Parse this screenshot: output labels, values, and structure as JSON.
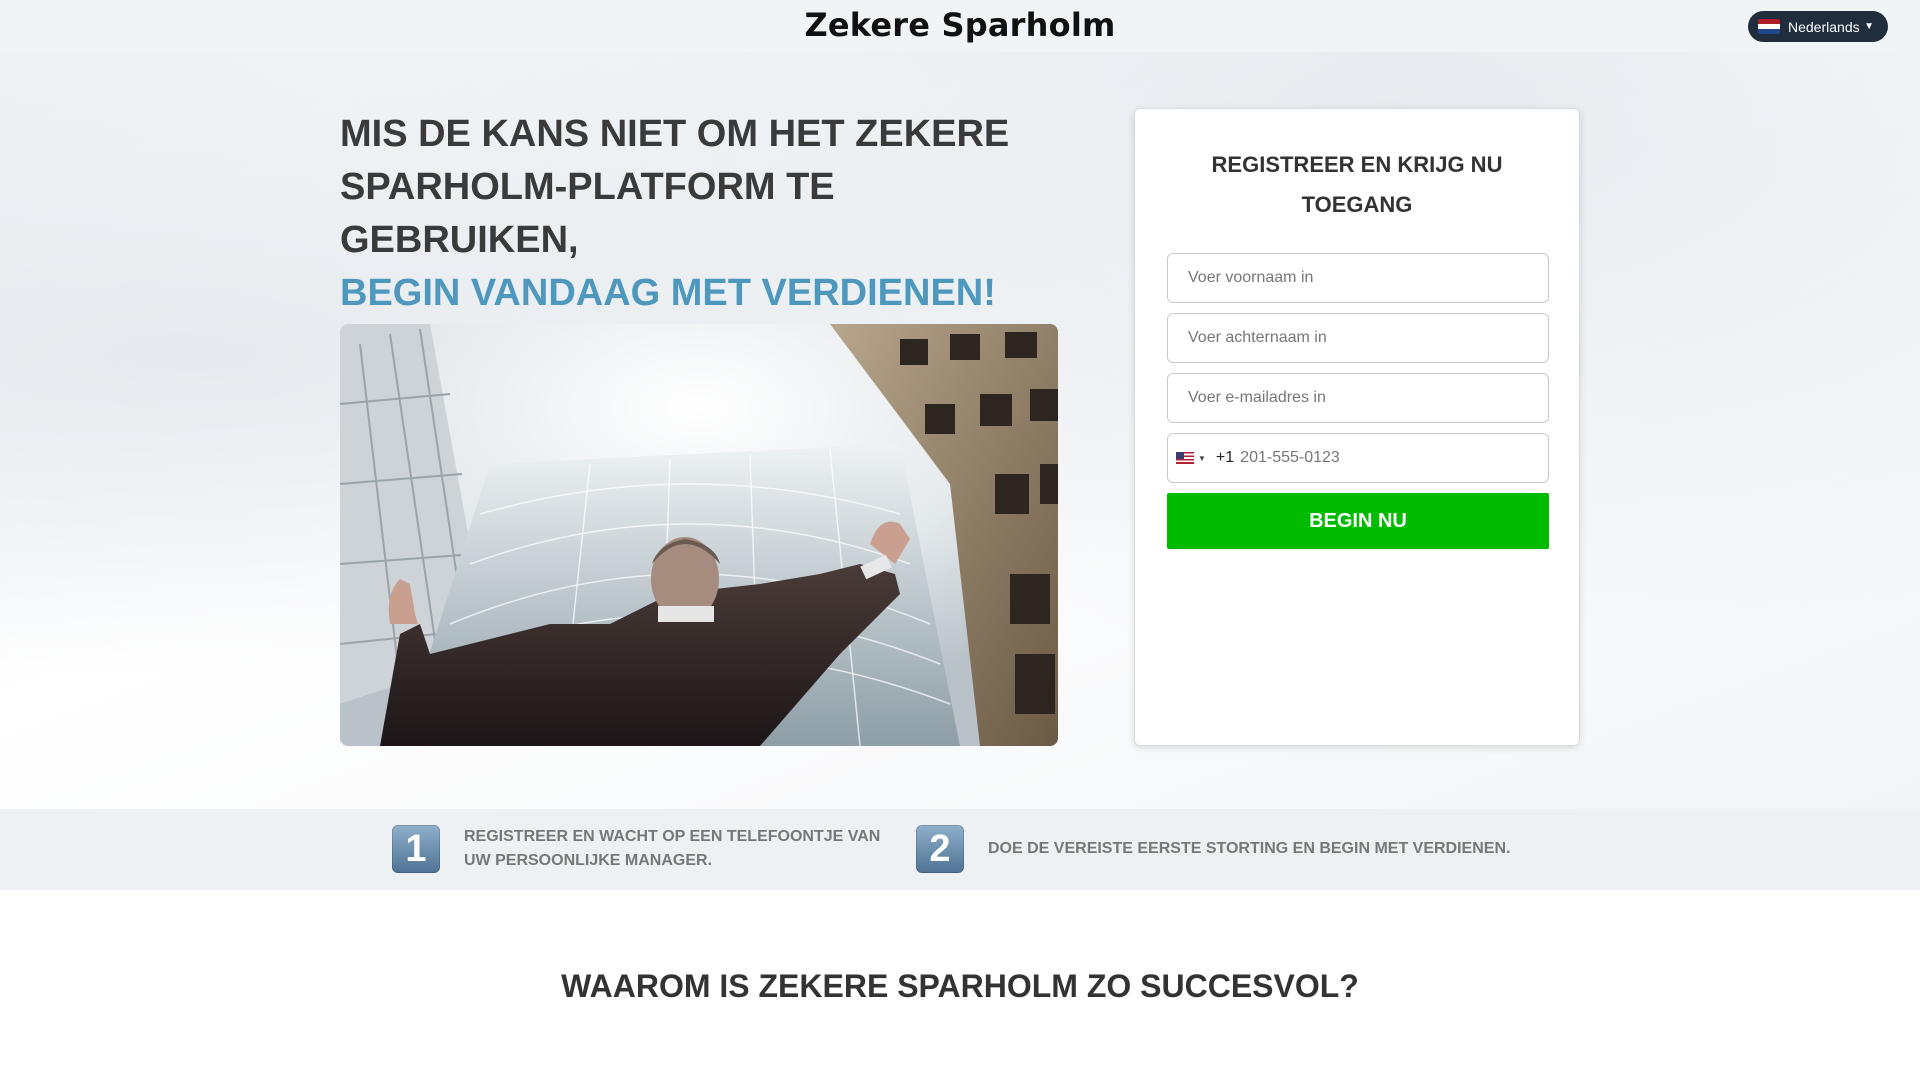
{
  "header": {
    "brand": "Zekere Sparholm",
    "language": {
      "label": "Nederlands",
      "flag_icon": "netherlands-flag-icon",
      "caret": "▼"
    }
  },
  "hero": {
    "headline_line1": "MIS DE KANS NIET OM HET ZEKERE",
    "headline_line2": "SPARHOLM-PLATFORM TE GEBRUIKEN,",
    "headline_accent": "BEGIN VANDAAG MET VERDIENEN!",
    "accent_color": "#4e97bd"
  },
  "form": {
    "title_line1": "REGISTREER EN KRIJG NU",
    "title_line2": "TOEGANG",
    "first_name_placeholder": "Voer voornaam in",
    "last_name_placeholder": "Voer achternaam in",
    "email_placeholder": "Voer e-mailadres in",
    "phone_flag_icon": "us-flag-icon",
    "phone_code": "+1",
    "phone_placeholder": "201-555-0123",
    "submit_label": "BEGIN NU",
    "submit_color": "#00bb00"
  },
  "steps": [
    {
      "number": "1",
      "text_line1": "REGISTREER EN WACHT OP EEN TELEFOONTJE VAN",
      "text_line2": "UW PERSOONLIJKE MANAGER."
    },
    {
      "number": "2",
      "text_line1": "DOE DE VEREISTE EERSTE STORTING EN BEGIN MET VERDIENEN."
    }
  ],
  "why": {
    "heading": "WAAROM IS ZEKERE SPARHOLM ZO SUCCESVOL?"
  }
}
